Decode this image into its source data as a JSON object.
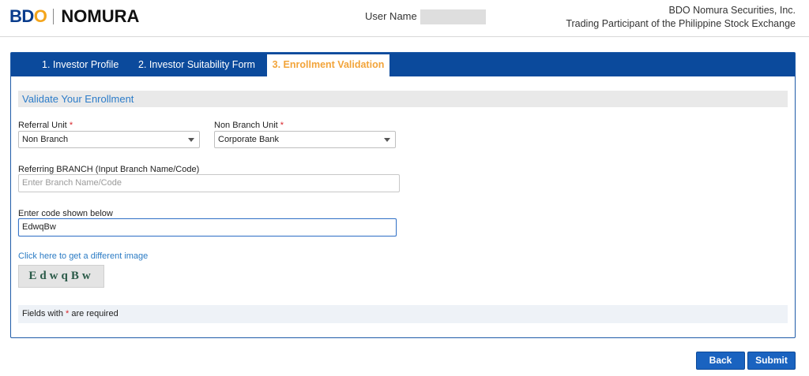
{
  "header": {
    "logo_bdo": "BD",
    "logo_bdo_o": "O",
    "logo_nomura": "NOMURA",
    "user_label": "User Name :",
    "company_name": "BDO Nomura Securities, Inc.",
    "company_subtitle": "Trading Participant of the Philippine Stock Exchange"
  },
  "tabs": [
    {
      "label": "1. Investor Profile",
      "active": false
    },
    {
      "label": "2. Investor Suitability Form",
      "active": false
    },
    {
      "label": "3. Enrollment Validation",
      "active": true
    }
  ],
  "section": {
    "title": "Validate Your Enrollment"
  },
  "form": {
    "referral_unit": {
      "label": "Referral Unit",
      "required_mark": "*",
      "value": "Non Branch"
    },
    "non_branch_unit": {
      "label": "Non Branch Unit",
      "required_mark": "*",
      "value": "Corporate Bank"
    },
    "referring_branch": {
      "label": "Referring BRANCH (Input Branch Name/Code)",
      "placeholder": "Enter Branch Name/Code"
    },
    "code": {
      "label": "Enter code shown below",
      "value": "EdwqBw"
    },
    "refresh_link": "Click here to get a different image",
    "captcha_text": "EdwqBw"
  },
  "note": {
    "prefix": "Fields with",
    "mark": "*",
    "suffix": "are required"
  },
  "buttons": {
    "back": "Back",
    "submit": "Submit"
  },
  "colors": {
    "brand_blue": "#0b4a9c",
    "brand_orange": "#f4a51c",
    "active_tab_text": "#f2a43a",
    "link": "#2b7bc4",
    "required": "#d9262b"
  }
}
